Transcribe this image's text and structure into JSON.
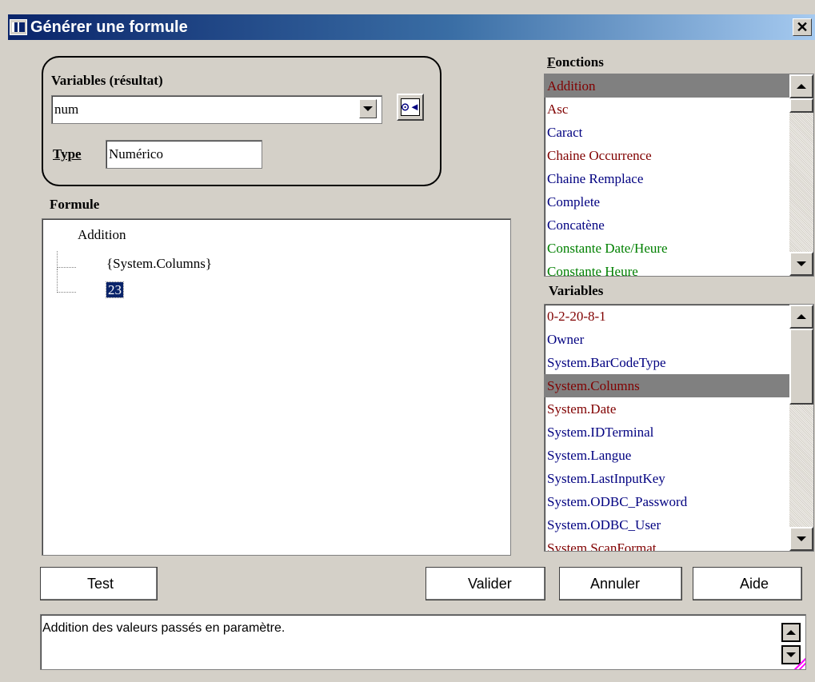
{
  "window": {
    "title": "Générer une formule",
    "close_label": "✕"
  },
  "result_group": {
    "label": "Variables (résultat)",
    "selected_variable": "num",
    "type_label": "Type",
    "type_value": "Numérico"
  },
  "formula": {
    "label": "Formule",
    "root": "Addition",
    "children": [
      "{System.Columns}",
      "23"
    ]
  },
  "functions": {
    "label": "Fonctions",
    "items": [
      {
        "text": "Addition",
        "color": "#800000",
        "selected": true
      },
      {
        "text": "Asc",
        "color": "#800000"
      },
      {
        "text": "Caract",
        "color": "#000080"
      },
      {
        "text": "Chaine Occurrence",
        "color": "#800000"
      },
      {
        "text": "Chaine Remplace",
        "color": "#000080"
      },
      {
        "text": "Complete",
        "color": "#000080"
      },
      {
        "text": "Concatène",
        "color": "#000080"
      },
      {
        "text": "Constante Date/Heure",
        "color": "#008000"
      },
      {
        "text": "Constante Heure",
        "color": "#008000"
      }
    ]
  },
  "variables": {
    "label": "Variables",
    "items": [
      {
        "text": "0-2-20-8-1",
        "color": "#800000"
      },
      {
        "text": "Owner",
        "color": "#000080"
      },
      {
        "text": "System.BarCodeType",
        "color": "#000080"
      },
      {
        "text": "System.Columns",
        "color": "#800000",
        "selected": true
      },
      {
        "text": "System.Date",
        "color": "#800000"
      },
      {
        "text": "System.IDTerminal",
        "color": "#000080"
      },
      {
        "text": "System.Langue",
        "color": "#000080"
      },
      {
        "text": "System.LastInputKey",
        "color": "#000080"
      },
      {
        "text": "System.ODBC_Password",
        "color": "#000080"
      },
      {
        "text": "System.ODBC_User",
        "color": "#000080"
      },
      {
        "text": "System.ScanFormat",
        "color": "#800000"
      }
    ]
  },
  "buttons": {
    "test": "Test",
    "validate": "Valider",
    "cancel": "Annuler",
    "help": "Aide"
  },
  "description": "Addition des valeurs passés en paramètre."
}
